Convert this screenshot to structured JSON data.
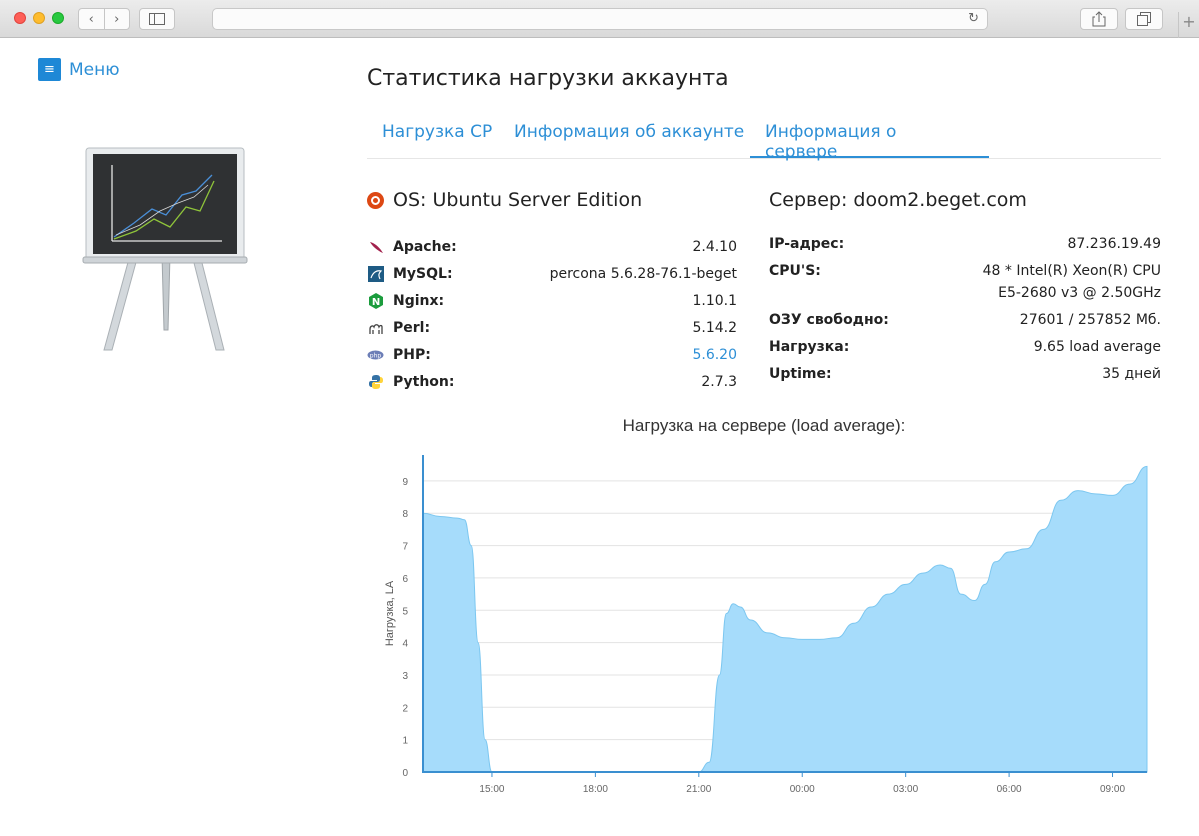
{
  "menu": {
    "label": "Меню"
  },
  "page": {
    "title": "Статистика нагрузки аккаунта"
  },
  "tabs": [
    {
      "label": "Нагрузка CP"
    },
    {
      "label": "Информация об аккаунте"
    },
    {
      "label": "Информация о сервере",
      "active": true
    }
  ],
  "os": {
    "title": "OS: Ubuntu Server Edition"
  },
  "server": {
    "title": "Сервер: doom2.beget.com"
  },
  "software": [
    {
      "name": "Apache:",
      "version": "2.4.10",
      "icon": "apache-feather-icon"
    },
    {
      "name": "MySQL:",
      "version": "percona 5.6.28-76.1-beget",
      "icon": "mysql-dolphin-icon"
    },
    {
      "name": "Nginx:",
      "version": "1.10.1",
      "icon": "nginx-icon"
    },
    {
      "name": "Perl:",
      "version": "5.14.2",
      "icon": "perl-camel-icon"
    },
    {
      "name": "PHP:",
      "version": "5.6.20",
      "icon": "php-icon",
      "link": true
    },
    {
      "name": "Python:",
      "version": "2.7.3",
      "icon": "python-icon"
    }
  ],
  "server_info": [
    {
      "name": "IP-адрес:",
      "value": "87.236.19.49"
    },
    {
      "name": "CPU'S:",
      "value": "48 * Intel(R) Xeon(R) CPU E5-2680 v3 @ 2.50GHz"
    },
    {
      "name": "ОЗУ свободно:",
      "value": "27601 / 257852 Мб."
    },
    {
      "name": "Нагрузка:",
      "value": "9.65 load average"
    },
    {
      "name": "Uptime:",
      "value": "35 дней"
    }
  ],
  "colors": {
    "accent": "#2d8fd6",
    "area_fill": "#a6dcfb",
    "area_stroke": "#7cc7f0"
  },
  "chart_data": {
    "type": "area",
    "title": "Нагрузка на сервере (load average):",
    "ylabel": "Нагрузка, LA",
    "xlabel": "",
    "ylim": [
      0,
      9.8
    ],
    "yticks": [
      0,
      1,
      2,
      3,
      4,
      5,
      6,
      7,
      8,
      9
    ],
    "xlim": [
      13.0,
      34.0
    ],
    "xticks": [
      {
        "x": 15,
        "label": "15:00"
      },
      {
        "x": 18,
        "label": "18:00"
      },
      {
        "x": 21,
        "label": "21:00"
      },
      {
        "x": 24,
        "label": "00:00"
      },
      {
        "x": 27,
        "label": "03:00"
      },
      {
        "x": 30,
        "label": "06:00"
      },
      {
        "x": 33,
        "label": "09:00"
      }
    ],
    "grid": true,
    "x": [
      13.0,
      13.5,
      14.0,
      14.2,
      14.4,
      14.6,
      14.8,
      15.0,
      15.5,
      16.0,
      17.0,
      18.0,
      19.0,
      20.0,
      21.0,
      21.3,
      21.6,
      21.8,
      22.0,
      22.2,
      22.5,
      23.0,
      23.5,
      24.0,
      24.5,
      25.0,
      25.5,
      26.0,
      26.5,
      27.0,
      27.5,
      28.0,
      28.3,
      28.6,
      29.0,
      29.3,
      29.6,
      30.0,
      30.5,
      31.0,
      31.5,
      32.0,
      32.5,
      33.0,
      33.5,
      34.0
    ],
    "y": [
      8.0,
      7.9,
      7.85,
      7.8,
      7.0,
      4.0,
      1.0,
      0.0,
      0.0,
      0.0,
      0.0,
      0.0,
      0.0,
      0.0,
      0.0,
      0.3,
      3.0,
      4.9,
      5.2,
      5.1,
      4.7,
      4.3,
      4.15,
      4.1,
      4.1,
      4.15,
      4.6,
      5.1,
      5.5,
      5.8,
      6.15,
      6.4,
      6.3,
      5.5,
      5.3,
      5.8,
      6.5,
      6.8,
      6.9,
      7.5,
      8.4,
      8.7,
      8.6,
      8.55,
      8.9,
      9.45
    ]
  }
}
